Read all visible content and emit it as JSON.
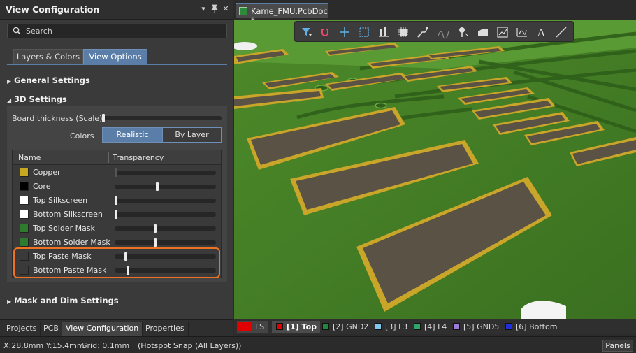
{
  "panel": {
    "title": "View Configuration",
    "search_placeholder": "Search",
    "tabs": [
      "Layers & Colors",
      "View Options"
    ],
    "active_tab": "View Options",
    "sections": {
      "general": "General Settings",
      "settings3d": "3D Settings",
      "mask": "Mask and Dim Settings"
    },
    "board_thickness_label": "Board thickness (Scale)",
    "board_thickness_value": 0.0,
    "colors_label": "Colors",
    "colors_options": [
      "Realistic",
      "By Layer"
    ],
    "colors_selected": "Realistic",
    "table": {
      "col_name": "Name",
      "col_transparency": "Transparency",
      "rows": [
        {
          "name": "Copper",
          "color": "#c8a820",
          "transparency": 0.0,
          "enabled": false
        },
        {
          "name": "Core",
          "color": "#000000",
          "transparency": 0.42,
          "enabled": true
        },
        {
          "name": "Top Silkscreen",
          "color": "#ffffff",
          "transparency": 0.0,
          "enabled": true
        },
        {
          "name": "Bottom Silkscreen",
          "color": "#ffffff",
          "transparency": 0.0,
          "enabled": true
        },
        {
          "name": "Top Solder Mask",
          "color": "#2e7a2e",
          "transparency": 0.4,
          "enabled": true
        },
        {
          "name": "Bottom Solder Mask",
          "color": "#2e7a2e",
          "transparency": 0.4,
          "enabled": true
        },
        {
          "name": "Top Paste Mask",
          "color": "#3a3a3a",
          "transparency": 0.1,
          "enabled": true
        },
        {
          "name": "Bottom Paste Mask",
          "color": "#3a3a3a",
          "transparency": 0.12,
          "enabled": true
        }
      ]
    },
    "bottom_tabs": [
      "Projects",
      "PCB",
      "View Configuration",
      "Properties"
    ],
    "active_bottom_tab": "View Configuration"
  },
  "document": {
    "tab_title": "Kame_FMU.PcbDoc *"
  },
  "toolbar_icons": [
    "filter-icon",
    "magnet-icon",
    "plus-icon",
    "select-rect-icon",
    "align-icon",
    "component-icon",
    "route-icon",
    "diff-pair-icon",
    "pin-icon",
    "polygon-icon",
    "graph-icon",
    "dimension-icon",
    "text-icon",
    "line-icon"
  ],
  "layers": [
    {
      "label": "LS",
      "color": "#e00000",
      "active": false
    },
    {
      "label": "[1] Top",
      "color": "#e00000",
      "active": true
    },
    {
      "label": "[2] GND2",
      "color": "#1b8a3a",
      "active": false
    },
    {
      "label": "[3] L3",
      "color": "#7ec8ee",
      "active": false
    },
    {
      "label": "[4] L4",
      "color": "#2ea86a",
      "active": false
    },
    {
      "label": "[5] GND5",
      "color": "#9c7bd8",
      "active": false
    },
    {
      "label": "[6] Bottom",
      "color": "#2030e0",
      "active": false
    }
  ],
  "status": {
    "coords": "X:28.8mm Y:15.4mm",
    "grid": "Grid: 0.1mm",
    "snap": "(Hotspot Snap (All Layers))",
    "panels_button": "Panels"
  }
}
